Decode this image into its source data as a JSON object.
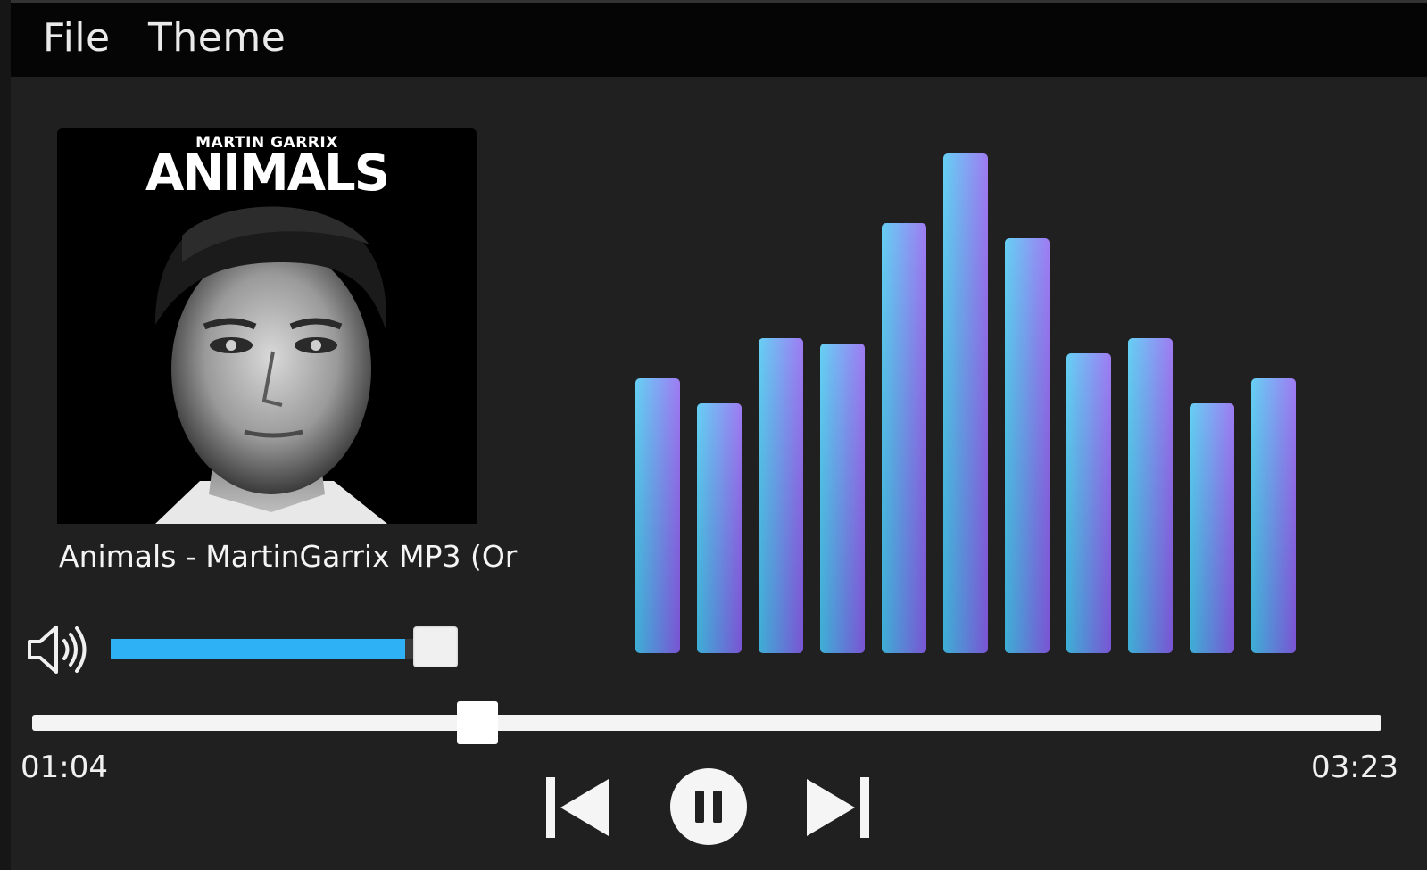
{
  "menu": {
    "file": "File",
    "theme": "Theme"
  },
  "album": {
    "artist_text": "MARTIN GARRIX",
    "album_text": "ANIMALS"
  },
  "track": {
    "title": "Animals - MartinGarrix MP3 (Or"
  },
  "volume": {
    "icon": "speaker-volume-icon",
    "level": 0.97,
    "fill_color": "#2fb1f5"
  },
  "playback": {
    "elapsed": "01:04",
    "total": "03:23",
    "progress": 0.33
  },
  "controls": {
    "previous_icon": "skip-previous-icon",
    "pause_icon": "pause-icon",
    "next_icon": "skip-next-icon"
  },
  "visualizer": {
    "levels": [
      0.55,
      0.5,
      0.63,
      0.62,
      0.86,
      1.0,
      0.83,
      0.6,
      0.63,
      0.5,
      0.55
    ],
    "color_start": "#45c6f2",
    "color_end": "#8a5ff0"
  }
}
